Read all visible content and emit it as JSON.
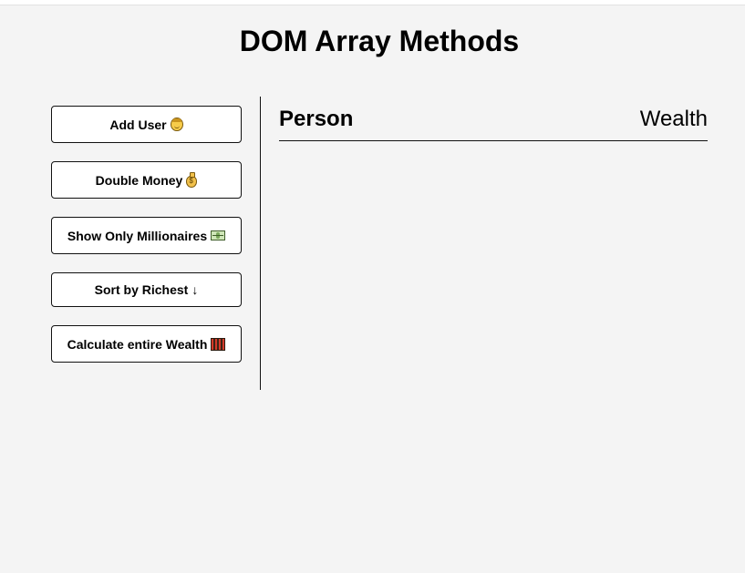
{
  "page": {
    "title": "DOM Array Methods"
  },
  "sidebar": {
    "buttons": [
      {
        "label": "Add User",
        "icon": "man-icon"
      },
      {
        "label": "Double Money",
        "icon": "money-bag-icon"
      },
      {
        "label": "Show Only Millionaires",
        "icon": "dollar-banknote-icon"
      },
      {
        "label": "Sort by Richest",
        "icon": "down-arrow-icon",
        "glyph": "↓"
      },
      {
        "label": "Calculate entire Wealth",
        "icon": "abacus-icon"
      }
    ]
  },
  "main": {
    "columns": {
      "person": "Person",
      "wealth": "Wealth"
    },
    "rows": []
  }
}
